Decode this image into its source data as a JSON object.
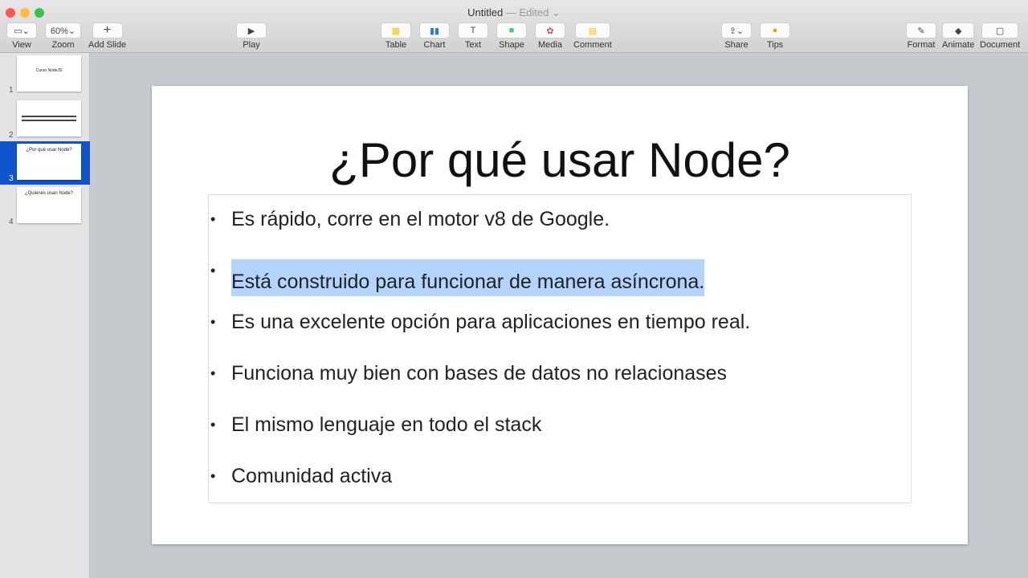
{
  "window": {
    "title": "Untitled",
    "status": "— Edited ⌄"
  },
  "toolbar": {
    "view": "View",
    "zoom": "Zoom",
    "zoom_value": "60%⌄",
    "add_slide": "Add Slide",
    "play": "Play",
    "table": "Table",
    "chart": "Chart",
    "text": "Text",
    "shape": "Shape",
    "media": "Media",
    "comment": "Comment",
    "share": "Share",
    "tips": "Tips",
    "format": "Format",
    "animate": "Animate",
    "document": "Document"
  },
  "slides": [
    {
      "num": "1",
      "title": "Curso NodeJS"
    },
    {
      "num": "2",
      "title": ""
    },
    {
      "num": "3",
      "title": "¿Por qué usar Node?"
    },
    {
      "num": "4",
      "title": "¿Quiénes usan Node?"
    }
  ],
  "selected_slide": 3,
  "slide": {
    "title": "¿Por qué usar Node?",
    "bullets": [
      "Es rápido, corre en el motor v8 de Google.",
      "Está construido para funcionar de manera asíncrona.",
      "Es una excelente opción para aplicaciones en tiempo real.",
      "Funciona muy bien con bases de datos no relacionases",
      "El mismo lenguaje en todo el stack",
      "Comunidad activa"
    ]
  },
  "colors": {
    "selection": "#b3d4fc",
    "sidebar_selected": "#1155cc"
  }
}
